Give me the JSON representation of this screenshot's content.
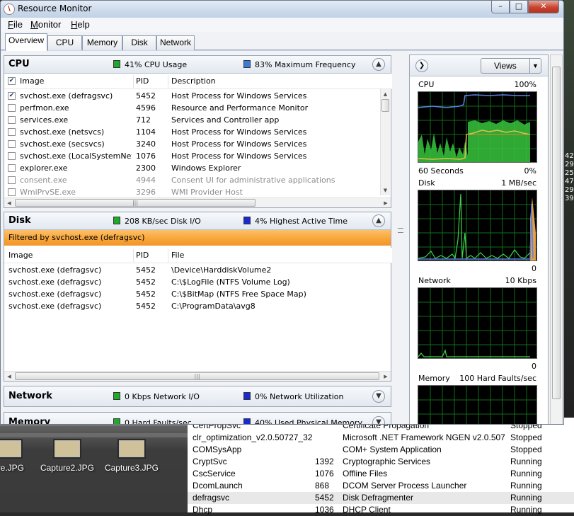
{
  "window": {
    "title": "Resource Monitor",
    "min": "–",
    "max": "□",
    "close": "✕"
  },
  "menu": {
    "items": [
      {
        "pre": "F",
        "rest": "ile"
      },
      {
        "pre": "M",
        "rest": "onitor"
      },
      {
        "pre": "H",
        "rest": "elp"
      }
    ]
  },
  "tabs": [
    "Overview",
    "CPU",
    "Memory",
    "Disk",
    "Network"
  ],
  "cpu_panel": {
    "title": "CPU",
    "stat1": "41% CPU Usage",
    "stat1_color": "#1faa2c",
    "stat2": "83% Maximum Frequency",
    "stat2_color": "#3a7ad8",
    "columns": [
      "Image",
      "PID",
      "Description"
    ],
    "rows": [
      {
        "image": "svchost.exe (defragsvc)",
        "pid": "5452",
        "desc": "Host Process for Windows Services",
        "checked": "✔"
      },
      {
        "image": "perfmon.exe",
        "pid": "4596",
        "desc": "Resource and Performance Monitor",
        "checked": ""
      },
      {
        "image": "services.exe",
        "pid": "712",
        "desc": "Services and Controller app",
        "checked": ""
      },
      {
        "image": "svchost.exe (netsvcs)",
        "pid": "1104",
        "desc": "Host Process for Windows Services",
        "checked": ""
      },
      {
        "image": "svchost.exe (secsvcs)",
        "pid": "3240",
        "desc": "Host Process for Windows Services",
        "checked": ""
      },
      {
        "image": "svchost.exe (LocalSystemNet...",
        "pid": "1076",
        "desc": "Host Process for Windows Services",
        "checked": ""
      },
      {
        "image": "explorer.exe",
        "pid": "2300",
        "desc": "Windows Explorer",
        "checked": ""
      },
      {
        "image": "consent.exe",
        "pid": "4944",
        "desc": "Consent UI for administrative applications",
        "checked": ""
      },
      {
        "image": "WmiPrvSE.exe",
        "pid": "3296",
        "desc": "WMI Provider Host",
        "checked": ""
      }
    ]
  },
  "disk_panel": {
    "title": "Disk",
    "stat1": "208 KB/sec Disk I/O",
    "stat1_color": "#1faa2c",
    "stat2": "4% Highest Active Time",
    "stat2_color": "#1b2ad0",
    "filter": "Filtered by svchost.exe (defragsvc)",
    "columns": [
      "Image",
      "PID",
      "File"
    ],
    "rows": [
      {
        "image": "svchost.exe (defragsvc)",
        "pid": "5452",
        "file": "\\Device\\HarddiskVolume2"
      },
      {
        "image": "svchost.exe (defragsvc)",
        "pid": "5452",
        "file": "C:\\$LogFile (NTFS Volume Log)"
      },
      {
        "image": "svchost.exe (defragsvc)",
        "pid": "5452",
        "file": "C:\\$BitMap (NTFS Free Space Map)"
      },
      {
        "image": "svchost.exe (defragsvc)",
        "pid": "5452",
        "file": "C:\\ProgramData\\avg8"
      }
    ]
  },
  "network_panel": {
    "title": "Network",
    "stat1": "0 Kbps Network I/O",
    "stat1_color": "#1faa2c",
    "stat2": "0% Network Utilization",
    "stat2_color": "#1b2ad0"
  },
  "memory_panel": {
    "title": "Memory",
    "stat1": "0 Hard Faults/sec",
    "stat1_color": "#1faa2c",
    "stat2": "40% Used Physical Memory",
    "stat2_color": "#1b2ad0"
  },
  "graphs": {
    "views_label": "Views",
    "cpu": {
      "label": "CPU",
      "max": "100%",
      "time": "60 Seconds",
      "min": "0%"
    },
    "disk": {
      "label": "Disk",
      "max": "1 MB/sec",
      "min": "0"
    },
    "network": {
      "label": "Network",
      "max": "10 Kbps",
      "min": "0"
    },
    "memory": {
      "label": "Memory",
      "max": "100 Hard Faults/sec"
    }
  },
  "desktop": {
    "icons": [
      "ure.JPG",
      "Capture2.JPG",
      "Capture3.JPG"
    ]
  },
  "services": {
    "rows": [
      {
        "name": "CertPropSvc",
        "pid": "",
        "desc": "Certificate Propagation",
        "status": "Stopped"
      },
      {
        "name": "clr_optimization_v2.0.50727_32",
        "pid": "",
        "desc": "Microsoft .NET Framework NGEN v2.0.5072...",
        "status": "Stopped"
      },
      {
        "name": "COMSysApp",
        "pid": "",
        "desc": "COM+ System Application",
        "status": "Stopped"
      },
      {
        "name": "CryptSvc",
        "pid": "1392",
        "desc": "Cryptographic Services",
        "status": "Running"
      },
      {
        "name": "CscService",
        "pid": "1076",
        "desc": "Offline Files",
        "status": "Running"
      },
      {
        "name": "DcomLaunch",
        "pid": "868",
        "desc": "DCOM Server Process Launcher",
        "status": "Running"
      },
      {
        "name": "defragsvc",
        "pid": "5452",
        "desc": "Disk Defragmenter",
        "status": "Running"
      },
      {
        "name": "Dhcp",
        "pid": "1036",
        "desc": "DHCP Client",
        "status": "Running"
      }
    ]
  },
  "right_strip_text": [
    "42",
    "29",
    "25",
    "47",
    "29",
    "39"
  ]
}
